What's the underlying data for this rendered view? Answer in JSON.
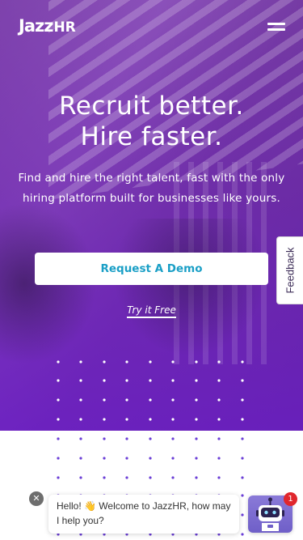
{
  "header": {
    "logo_main": "Jazz",
    "logo_suffix": "HR",
    "menu_icon": "hamburger-menu-icon"
  },
  "hero": {
    "headline_line1": "Recruit better.",
    "headline_line2": "Hire faster.",
    "subtext": "Find and hire the right talent, fast with the only hiring platform built for businesses like yours.",
    "primary_button": "Request A Demo",
    "secondary_link": "Try it Free"
  },
  "feedback": {
    "label": "Feedback"
  },
  "chat": {
    "close_icon": "close-icon",
    "message": "Hello! 👋 Welcome to JazzHR, how may I help you?",
    "bot_icon": "robot-icon",
    "unread_count": "1"
  },
  "colors": {
    "accent": "#1a9fc6",
    "hero_purple": "#7a2fd0",
    "dot_white": "#ffffff",
    "dot_purple": "#6b3fd6",
    "badge_red": "#e0262d"
  }
}
